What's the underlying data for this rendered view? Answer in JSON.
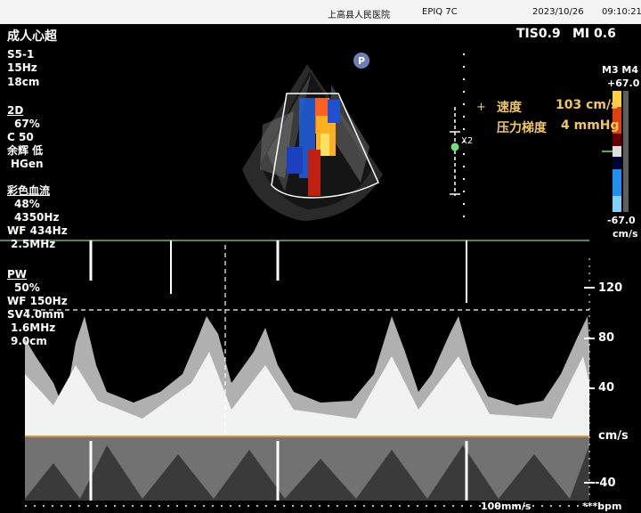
{
  "header": {
    "hospital": "上高县人民医院",
    "device": "EPIQ 7C",
    "date": "2023/10/26",
    "time": "09:10:21"
  },
  "preset": "成人心超",
  "safety": {
    "tis": "TIS0.9",
    "mi": "MI 0.6"
  },
  "probe": {
    "name": "S5-1",
    "framerate": "15Hz",
    "depth": "18cm"
  },
  "mode_2d": {
    "title": "2D",
    "gain": "67%",
    "compress": "C 50",
    "persist": "余辉 低",
    "mode": "HGen"
  },
  "color_flow": {
    "title": "彩色血流",
    "gain": "48%",
    "prf": "4350Hz",
    "wf": "WF 434Hz",
    "freq": "2.5MHz"
  },
  "pw": {
    "title": "PW",
    "gain": "50%",
    "wf": "WF 150Hz",
    "sv": "SV4.0mm",
    "freq": "1.6MHz",
    "depth": "9.0cm"
  },
  "measurement": {
    "velocity_label": "速度",
    "velocity_value": "103 cm/s",
    "gradient_label": "压力梯度",
    "gradient_value": "4 mmHg"
  },
  "color_scale": {
    "map": "M3 M4",
    "top": "+67.0",
    "bottom": "-67.0",
    "unit": "cm/s"
  },
  "zoom_label": "X2",
  "p_marker": "P",
  "doppler_axis": {
    "ticks": [
      "120",
      "80",
      "40",
      "-40"
    ],
    "unit": "cm/s"
  },
  "sweep": {
    "speed": "100mm/s",
    "hr": "***bpm"
  },
  "colors": {
    "baseline": "#d99640",
    "green": "#6fe07f",
    "meas": "#f0c860"
  }
}
